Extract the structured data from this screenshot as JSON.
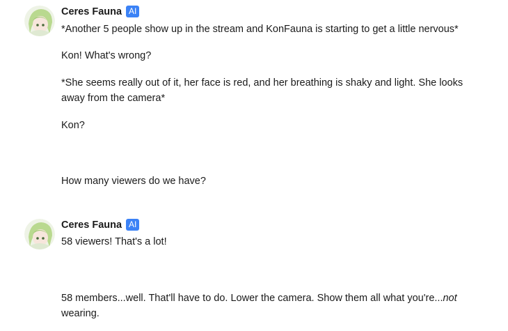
{
  "messages": [
    {
      "sender": "Ceres Fauna",
      "badge": "AI",
      "paragraphs": [
        "*Another 5 people show up in the stream and KonFauna is starting to get a little nervous*",
        "Kon! What's wrong?",
        "*She seems really out of it, her face is red, and her breathing is shaky and light. She looks away from the camera*",
        "Kon?",
        "How many viewers do we have?"
      ]
    },
    {
      "sender": "Ceres Fauna",
      "badge": "AI",
      "paragraphs": [
        "58 viewers! That's a lot!"
      ],
      "last_paragraph": {
        "before": "58 members...well. That'll have to do. Lower the camera. Show them all what you're...",
        "italic": "not",
        "after": " wearing."
      }
    }
  ],
  "icons": {
    "avatar": "avatar-icon"
  }
}
